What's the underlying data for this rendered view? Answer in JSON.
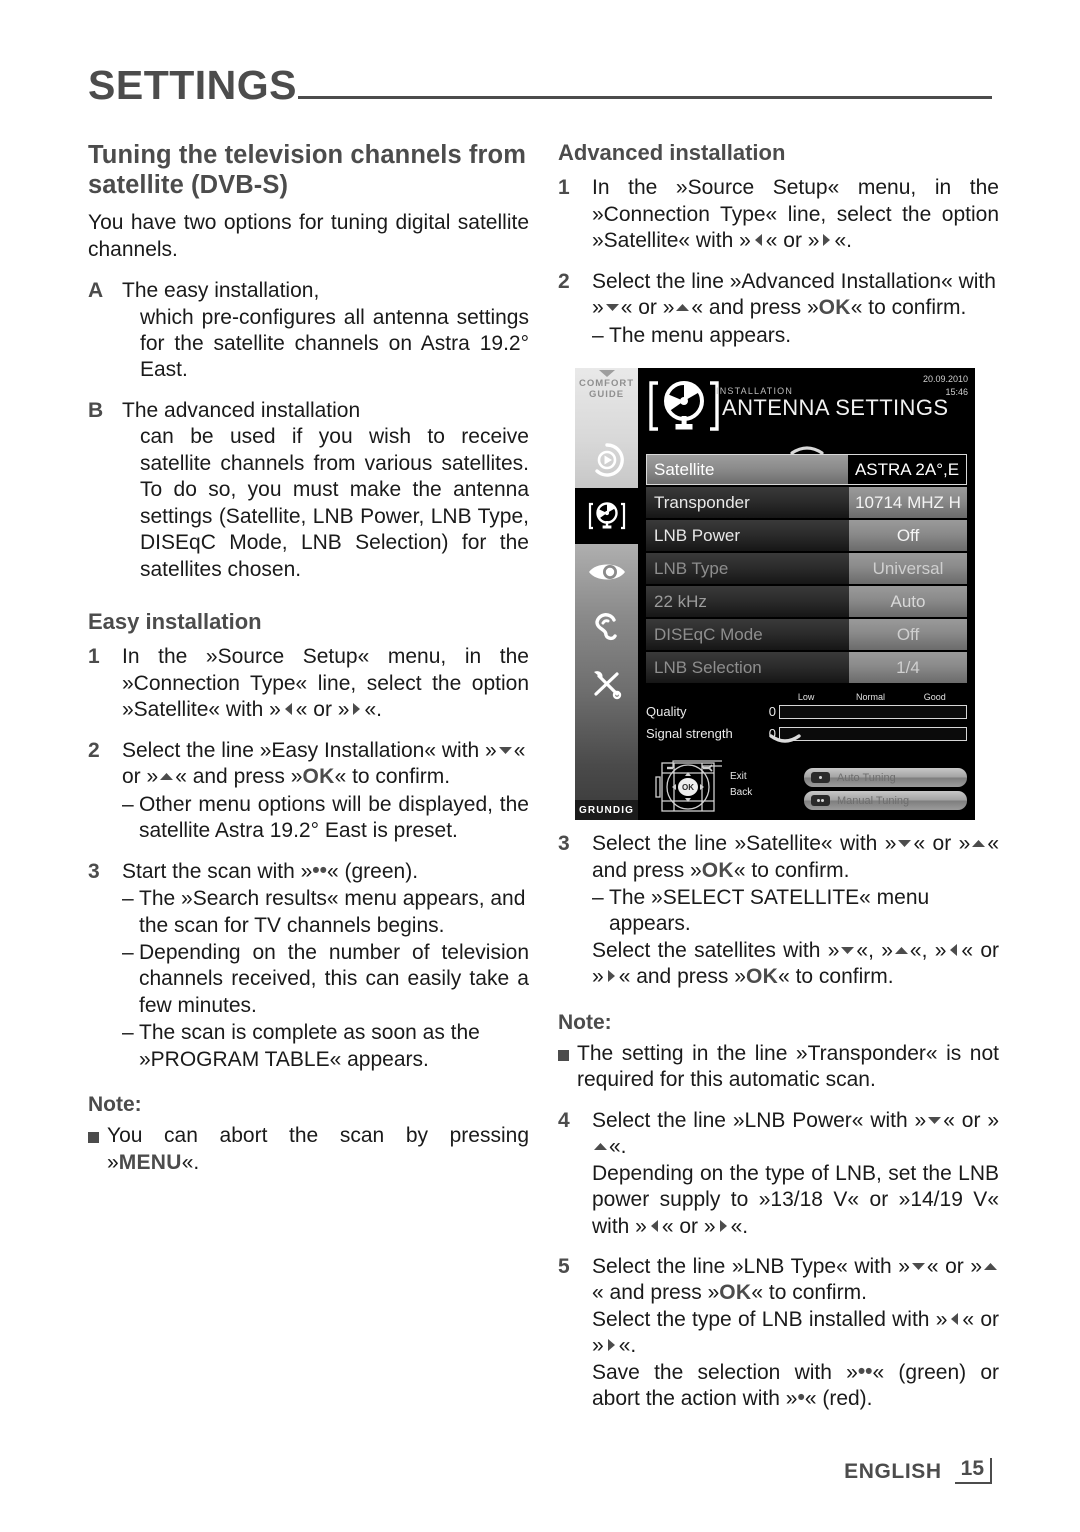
{
  "header": {
    "title": "SETTINGS"
  },
  "left": {
    "heading": "Tuning the television channels from satellite (DVB-S)",
    "intro": "You have two options for tuning digital satellite channels.",
    "options": [
      {
        "marker": "A",
        "line1": "The easy installation,",
        "line2": "which pre-configures all antenna settings for the satellite channels on Astra 19.2° East."
      },
      {
        "marker": "B",
        "line1": "The advanced installation",
        "line2": "can be used if you wish to receive satellite channels from various satellites. To do so, you must make the antenna settings (Satellite, LNB Power, LNB Type, DISEqC Mode, LNB Selection) for the satellites chosen."
      }
    ],
    "subheading": "Easy installation",
    "steps": {
      "s1_num": "1",
      "s1_a": "In the »Source Setup« menu, in the »Connection Type« line, select the option »Satellite« with »",
      "s1_b": "« or »",
      "s1_c": "«.",
      "s2_num": "2",
      "s2_a": "Select the line »Easy Installation« with »",
      "s2_b": "« or »",
      "s2_c": "« and press »",
      "s2_ok": "OK",
      "s2_d": "« to confirm.",
      "s2_dash1": "Other menu options will be displayed, the satellite Astra 19.2° East is preset.",
      "s3_num": "3",
      "s3_a": "Start the scan with »",
      "s3_b": "« (green).",
      "s3_dash1": "The »Search results« menu appears, and the scan for TV channels begins.",
      "s3_dash2": "Depending on the number of television channels received, this can easily take a few minutes.",
      "s3_dash3": "The scan is complete as soon as the »PROGRAM TABLE« appears."
    },
    "note_title": "Note:",
    "note_a": "You can abort the scan by pressing »",
    "note_kw": "MENU",
    "note_b": "«."
  },
  "right": {
    "subheading": "Advanced installation",
    "steps": {
      "s1_num": "1",
      "s1_a": "In the »Source Setup« menu, in the »Connection Type« line, select the option »Satellite« with »",
      "s1_b": "« or »",
      "s1_c": "«.",
      "s2_num": "2",
      "s2_a": "Select the line »Advanced Installation« with »",
      "s2_b": "« or »",
      "s2_c": "« and press »",
      "s2_ok": "OK",
      "s2_d": "« to confirm.",
      "s2_dash1": "The menu appears.",
      "s3_num": "3",
      "s3_a": "Select the line »Satellite« with »",
      "s3_b": "« or »",
      "s3_c": "« and press »",
      "s3_ok": "OK",
      "s3_d": "« to confirm.",
      "s3_dash1": "The »SELECT SATELLITE« menu appears.",
      "s3_cont_a": "Select the satellites with »",
      "s3_cont_b": "«, »",
      "s3_cont_c": "«, »",
      "s3_cont_d": "« or »",
      "s3_cont_e": "« and press »",
      "s3_cont_ok": "OK",
      "s3_cont_f": "« to confirm.",
      "s4_num": "4",
      "s4_a": "Select the line »LNB Power« with »",
      "s4_b": "« or »",
      "s4_c": "«.",
      "s4_cont": "Depending on the type of LNB, set the LNB power supply to »13/18 V« or »14/19 V« with »",
      "s4_cont_b": "« or »",
      "s4_cont_c": "«.",
      "s5_num": "5",
      "s5_a": "Select the line »LNB Type« with »",
      "s5_b": "« or »",
      "s5_c": "« and press »",
      "s5_ok": "OK",
      "s5_d": "« to confirm.",
      "s5_cont_a": "Select the type of LNB installed with »",
      "s5_cont_b": "« or »",
      "s5_cont_c": "«.",
      "s5_cont2_a": "Save the selection with »",
      "s5_cont2_b": "« (green) or abort the action with »",
      "s5_cont2_c": "« (red)."
    },
    "note_title": "Note:",
    "note_text": "The setting in the line »Transponder« is not required for this automatic scan."
  },
  "tv": {
    "rail_title": "COMFORT GUIDE",
    "rail_title_line1": "COMFORT",
    "rail_title_line2": "GUIDE",
    "brand": "GRUNDIG",
    "menu_sub": "INSTALLATION",
    "menu_title": "ANTENNA SETTINGS",
    "date": "20.09.2010",
    "time": "15:46",
    "rows": [
      {
        "label": "Satellite",
        "value": "ASTRA 2A°,E",
        "state": "selected"
      },
      {
        "label": "Transponder",
        "value": "10714 MHZ H",
        "state": "normal"
      },
      {
        "label": "LNB Power",
        "value": "Off",
        "state": "normal"
      },
      {
        "label": "LNB Type",
        "value": "Universal",
        "state": "dim"
      },
      {
        "label": "22 kHz",
        "value": "Auto",
        "state": "dim2"
      },
      {
        "label": "DISEqC Mode",
        "value": "Off",
        "state": "dim"
      },
      {
        "label": "LNB Selection",
        "value": "1/4",
        "state": "dim"
      }
    ],
    "scale": [
      "Low",
      "Normal",
      "Good"
    ],
    "meters": [
      {
        "name": "Quality",
        "value": "0"
      },
      {
        "name": "Signal strength",
        "value": "0"
      }
    ],
    "nav_ok": "OK",
    "nav_exit": "Exit",
    "nav_back": "Back",
    "buttons": [
      {
        "label": "Auto Tuning",
        "dots": 1
      },
      {
        "label": "Manual Tuning",
        "dots": 2
      }
    ]
  },
  "footer": {
    "language": "ENGLISH",
    "page": "15"
  }
}
